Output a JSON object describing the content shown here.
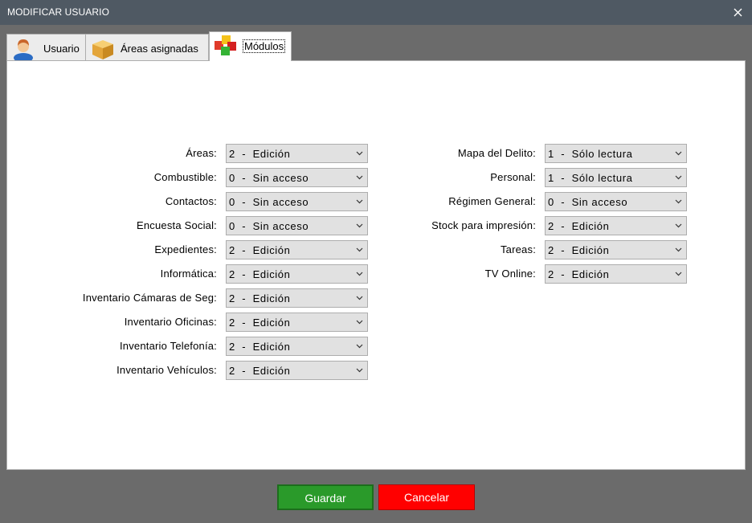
{
  "window": {
    "title": "MODIFICAR USUARIO",
    "close_icon": "close-icon"
  },
  "tabs": [
    {
      "label": "Usuario",
      "icon": "user-icon",
      "active": false
    },
    {
      "label": "Áreas asignadas",
      "icon": "box-icon",
      "active": false
    },
    {
      "label": "Módulos",
      "icon": "cubes-icon",
      "active": true
    }
  ],
  "modules_left": [
    {
      "label": "Áreas:",
      "value": "2  -  Edición"
    },
    {
      "label": "Combustible:",
      "value": "0  -  Sin acceso"
    },
    {
      "label": "Contactos:",
      "value": "0  -  Sin acceso"
    },
    {
      "label": "Encuesta Social:",
      "value": "0  -  Sin acceso"
    },
    {
      "label": "Expedientes:",
      "value": "2  -  Edición"
    },
    {
      "label": "Informática:",
      "value": "2  -  Edición"
    },
    {
      "label": "Inventario Cámaras de Seg:",
      "value": "2  -  Edición"
    },
    {
      "label": "Inventario Oficinas:",
      "value": "2  -  Edición"
    },
    {
      "label": "Inventario Telefonía:",
      "value": "2  -  Edición"
    },
    {
      "label": "Inventario Vehículos:",
      "value": "2  -  Edición"
    }
  ],
  "modules_right": [
    {
      "label": "Mapa del Delito:",
      "value": "1  -  Sólo lectura"
    },
    {
      "label": "Personal:",
      "value": "1  -  Sólo lectura"
    },
    {
      "label": "Régimen General:",
      "value": "0  -  Sin acceso"
    },
    {
      "label": "Stock para impresión:",
      "value": "2  -  Edición"
    },
    {
      "label": "Tareas:",
      "value": "2  -  Edición"
    },
    {
      "label": "TV Online:",
      "value": "2  -  Edición"
    }
  ],
  "buttons": {
    "save": "Guardar",
    "cancel": "Cancelar"
  },
  "colors": {
    "titlebar": "#4f5963",
    "save": "#2a9a2a",
    "cancel": "#ff0000",
    "backdrop": "#6b6b6b"
  }
}
